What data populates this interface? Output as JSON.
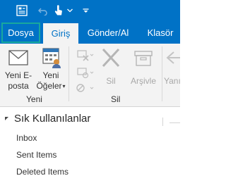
{
  "tabs": [
    {
      "label": "Dosya"
    },
    {
      "label": "Giriş"
    },
    {
      "label": "Gönder/Al"
    },
    {
      "label": "Klasör"
    }
  ],
  "ribbon": {
    "new_email_line1": "Yeni E-",
    "new_email_line2": "posta",
    "new_items_line1": "Yeni",
    "new_items_line2": "Öğeler",
    "group_new": "Yeni",
    "delete_label": "Sil",
    "archive_label": "Arşivle",
    "group_delete": "Sil",
    "reply_partial": "Yanı"
  },
  "nav": {
    "favorites_title": "Sık Kullanılanlar",
    "items": [
      "Inbox",
      "Sent Items",
      "Deleted Items"
    ]
  },
  "colors": {
    "accent": "#0072c6",
    "ribbon_bg": "#f3f3f3",
    "file_tab_border": "#18a89e"
  }
}
